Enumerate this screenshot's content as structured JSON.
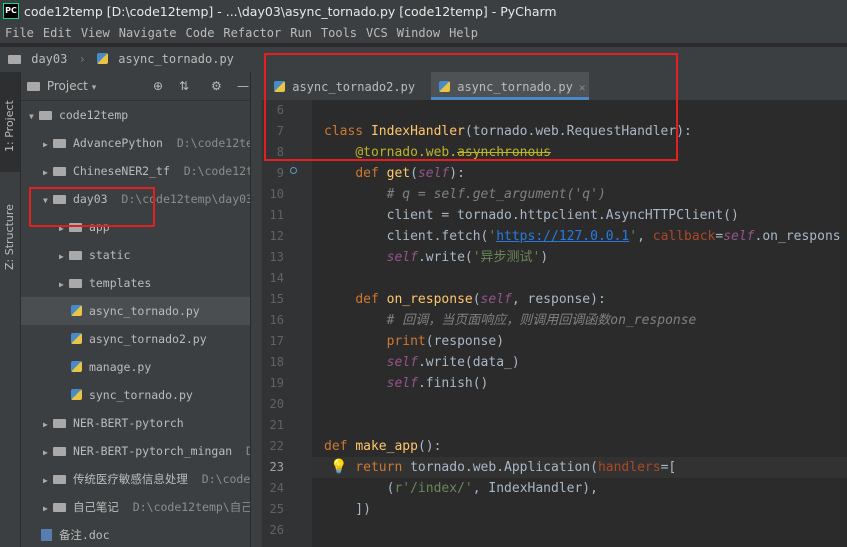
{
  "window": {
    "title": "code12temp [D:\\code12temp] - ...\\day03\\async_tornado.py [code12temp] - PyCharm",
    "app_icon": "PC"
  },
  "menu": [
    "File",
    "Edit",
    "View",
    "Navigate",
    "Code",
    "Refactor",
    "Run",
    "Tools",
    "VCS",
    "Window",
    "Help"
  ],
  "breadcrumb": {
    "folder": "day03",
    "file": "async_tornado.py"
  },
  "tool_windows": {
    "project": "1: Project",
    "structure": "Z: Structure"
  },
  "project_panel": {
    "title": "Project",
    "tree": [
      {
        "name": "code12temp",
        "path": "",
        "type": "folder",
        "expanded": true
      },
      {
        "name": "AdvancePython",
        "path": "D:\\code12te",
        "type": "folder",
        "expanded": false
      },
      {
        "name": "ChineseNER2_tf",
        "path": "D:\\code12t",
        "type": "folder",
        "expanded": false
      },
      {
        "name": "day03",
        "path": "D:\\code12temp\\day03",
        "type": "folder",
        "expanded": true
      },
      {
        "name": "app",
        "path": "",
        "type": "folder",
        "expanded": false
      },
      {
        "name": "static",
        "path": "",
        "type": "folder",
        "expanded": false
      },
      {
        "name": "templates",
        "path": "",
        "type": "folder",
        "expanded": false
      },
      {
        "name": "async_tornado.py",
        "path": "",
        "type": "py",
        "selected": true
      },
      {
        "name": "async_tornado2.py",
        "path": "",
        "type": "py"
      },
      {
        "name": "manage.py",
        "path": "",
        "type": "py"
      },
      {
        "name": "sync_tornado.py",
        "path": "",
        "type": "py"
      },
      {
        "name": "NER-BERT-pytorch",
        "path": "",
        "type": "folder",
        "expanded": false
      },
      {
        "name": "NER-BERT-pytorch_mingan",
        "path": "D",
        "type": "folder",
        "expanded": false
      },
      {
        "name": "传统医疗敏感信息处理",
        "path": "D:\\code1",
        "type": "folder",
        "expanded": false
      },
      {
        "name": "自己笔记",
        "path": "D:\\code12temp\\自己",
        "type": "folder",
        "expanded": false
      },
      {
        "name": "备注.doc",
        "path": "",
        "type": "doc"
      }
    ]
  },
  "tabs": [
    {
      "label": "async_tornado2.py",
      "active": false
    },
    {
      "label": "async_tornado.py",
      "active": true
    }
  ],
  "editor": {
    "current_line": "23",
    "lines": [
      {
        "n": "6",
        "text": ""
      },
      {
        "n": "7",
        "text": "class IndexHandler(tornado.web.RequestHandler):"
      },
      {
        "n": "8",
        "text": "    @tornado.web.asynchronous"
      },
      {
        "n": "9",
        "text": "    def get(self):"
      },
      {
        "n": "10",
        "text": "        # q = self.get_argument('q')"
      },
      {
        "n": "11",
        "text": "        client = tornado.httpclient.AsyncHTTPClient()"
      },
      {
        "n": "12",
        "text": "        client.fetch('https://127.0.0.1', callback=self.on_respons"
      },
      {
        "n": "13",
        "text": "        self.write('异步测试')"
      },
      {
        "n": "14",
        "text": ""
      },
      {
        "n": "15",
        "text": "    def on_response(self, response):"
      },
      {
        "n": "16",
        "text": "        # 回调，当页面响应，则调用回调函数on_response"
      },
      {
        "n": "17",
        "text": "        print(response)"
      },
      {
        "n": "18",
        "text": "        self.write(data_)"
      },
      {
        "n": "19",
        "text": "        self.finish()"
      },
      {
        "n": "20",
        "text": ""
      },
      {
        "n": "21",
        "text": ""
      },
      {
        "n": "22",
        "text": "def make_app():"
      },
      {
        "n": "23",
        "text": "    return tornado.web.Application(handlers=["
      },
      {
        "n": "24",
        "text": "        (r'/index/', IndexHandler),"
      },
      {
        "n": "25",
        "text": "    ])"
      },
      {
        "n": "26",
        "text": ""
      }
    ]
  },
  "colors": {
    "annotation": "#e32020",
    "accent": "#4a88c7"
  }
}
